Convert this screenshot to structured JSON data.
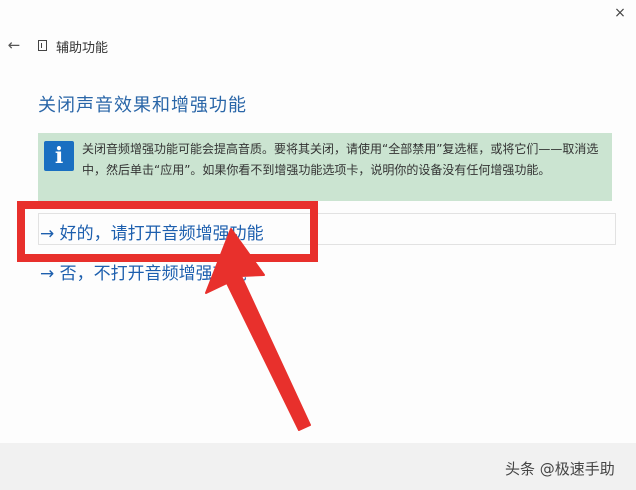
{
  "window": {
    "title": "辅助功能",
    "back_icon": "←",
    "close_icon": "×"
  },
  "main": {
    "heading": "关闭声音效果和增强功能",
    "info": {
      "icon": "i",
      "text": "关闭音频增强功能可能会提高音质。要将其关闭，请使用“全部禁用”复选框，或将它们——取消选中，然后单击“应用”。如果你看不到增强功能选项卡，说明你的设备没有任何增强功能。"
    },
    "options": {
      "yes": "→ 好的，请打开音频增强功能",
      "no": "→ 否，不打开音频增强功能"
    }
  },
  "annotation": {
    "color": "#e8302c"
  },
  "watermark": "头条 @极速手助"
}
